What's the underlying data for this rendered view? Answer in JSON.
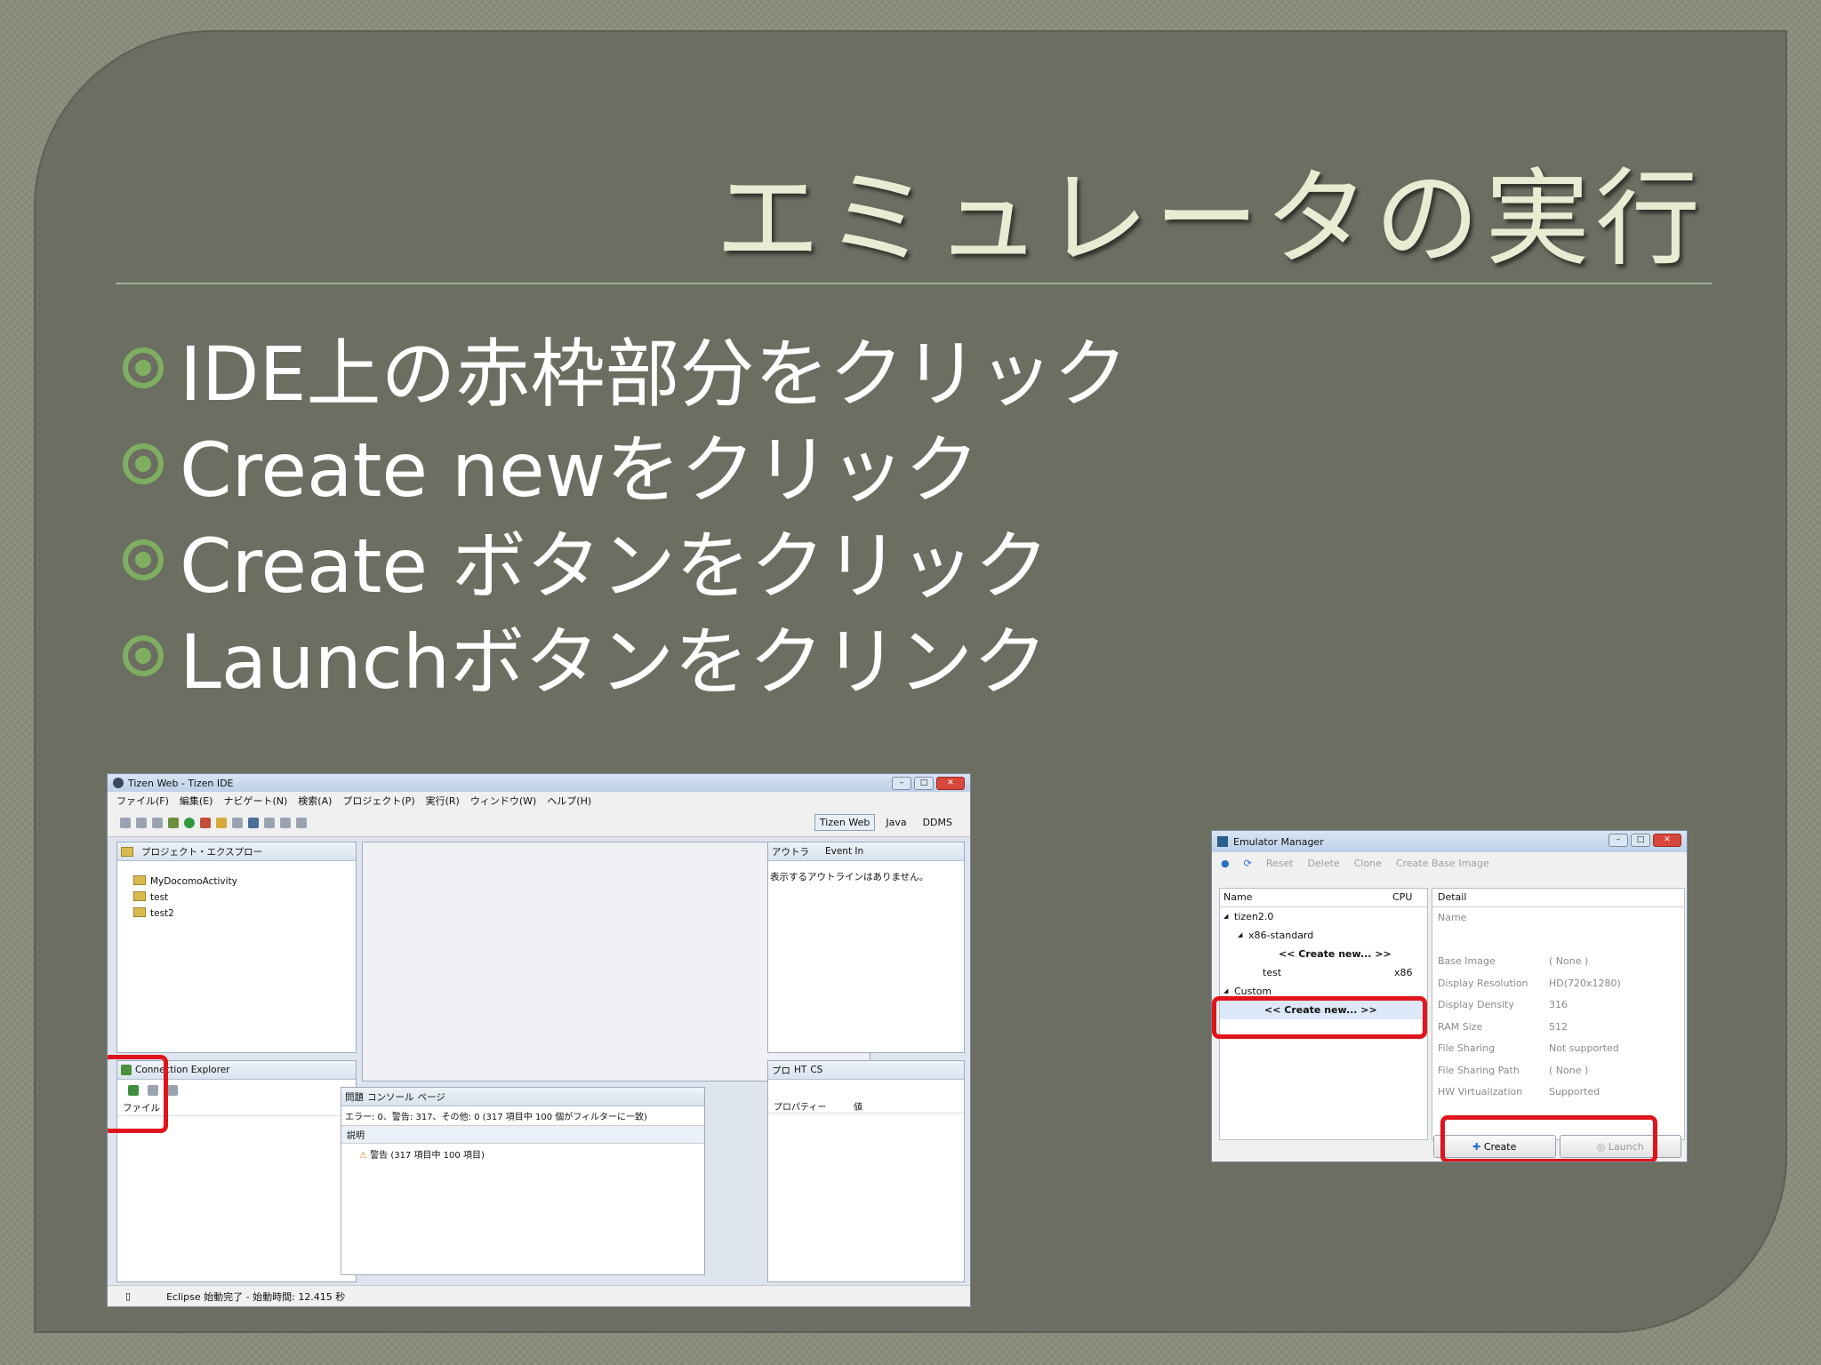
{
  "slide": {
    "title": "エミュレータの実行",
    "bullets": [
      "IDE上の赤枠部分をクリック",
      "Create newをクリック",
      "Create ボタンをクリック",
      "Launchボタンをクリンク"
    ],
    "bullet_icon": "circle-bullet-icon",
    "accent_color": "#7fae62"
  },
  "ide": {
    "window_title": "Tizen Web - Tizen IDE",
    "menu": [
      "ファイル(F)",
      "編集(E)",
      "ナビゲート(N)",
      "検索(A)",
      "プロジェクト(P)",
      "実行(R)",
      "ウィンドウ(W)",
      "ヘルプ(H)"
    ],
    "perspectives": [
      "Tizen Web",
      "Java",
      "DDMS"
    ],
    "project_explorer": {
      "title": "プロジェクト・エクスプロー",
      "items": [
        "MyDocomoActivity",
        "test",
        "test2"
      ]
    },
    "outline": {
      "tab1": "アウトラ",
      "tab2": "Event In",
      "empty_text": "表示するアウトラインはありません。"
    },
    "connection_explorer": {
      "title": "Connection Explorer",
      "column": "ファイル"
    },
    "problems": {
      "tabs": [
        "問題",
        "コンソール",
        "ページ"
      ],
      "summary": "エラー: 0、警告: 317、その他: 0 (317 項目中 100 個がフィルターに一致)",
      "column": "説明",
      "row": "警告 (317 項目中 100 項目)"
    },
    "properties": {
      "tabs": [
        "プロ",
        "HT",
        "CS"
      ],
      "col1": "プロパティー",
      "col2": "値"
    },
    "status": "Eclipse 始動完了 - 始動時間: 12.415 秒",
    "highlight_color": "#e0141b"
  },
  "emulator": {
    "window_title": "Emulator Manager",
    "toolbar": [
      "Reset",
      "Delete",
      "Clone",
      "Create Base Image"
    ],
    "list_headers": [
      "Name",
      "CPU"
    ],
    "tree": [
      {
        "label": "tizen2.0",
        "cpu": "",
        "indent": 1,
        "expander": "◢"
      },
      {
        "label": "x86-standard",
        "cpu": "",
        "indent": 2,
        "expander": "◢"
      },
      {
        "label": "<< Create new... >>",
        "cpu": "",
        "indent": 3,
        "bold": true
      },
      {
        "label": "test",
        "cpu": "x86",
        "indent": 3
      },
      {
        "label": "Custom",
        "cpu": "",
        "indent": 1,
        "expander": "◢"
      },
      {
        "label": "<< Create new... >>",
        "cpu": "",
        "indent": 2,
        "bold": true,
        "selected": true
      }
    ],
    "detail_header": "Detail",
    "details": [
      {
        "key": "Name",
        "value": ""
      },
      {
        "key": "",
        "value": ""
      },
      {
        "key": "Base Image",
        "value": "( None )"
      },
      {
        "key": "Display Resolution",
        "value": "HD(720x1280)"
      },
      {
        "key": "Display Density",
        "value": "316"
      },
      {
        "key": "RAM Size",
        "value": "512"
      },
      {
        "key": "File Sharing",
        "value": "Not supported"
      },
      {
        "key": "File Sharing Path",
        "value": "( None )"
      },
      {
        "key": "HW Virtualization",
        "value": "Supported"
      }
    ],
    "buttons": {
      "create": "Create",
      "launch": "Launch"
    }
  }
}
